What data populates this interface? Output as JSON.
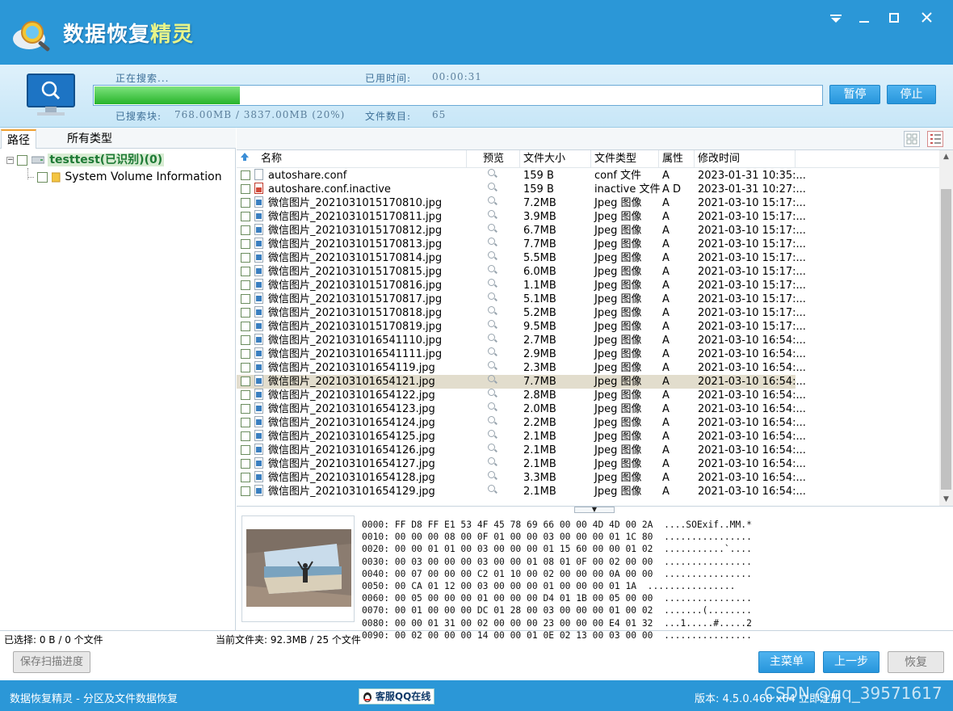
{
  "app": {
    "title_main": "数据恢复",
    "title_highlight": "精灵"
  },
  "window": {
    "min_icon": "minimize-icon",
    "max_icon": "maximize-icon",
    "close_icon": "close-icon"
  },
  "scan": {
    "status_label": "正在搜索...",
    "elapsed_label": "已用时间:",
    "elapsed_value": "00:00:31",
    "blocks_label": "已搜索块:",
    "blocks_value": "768.00MB / 3837.00MB (20%)",
    "files_label": "文件数目:",
    "files_value": "65",
    "progress": 0.2,
    "pause_label": "暂停",
    "stop_label": "停止"
  },
  "tabs": {
    "path": "路径",
    "types": "所有类型"
  },
  "tree": {
    "root": "testtest(已识别)(0)",
    "child": "System Volume Information"
  },
  "columns": {
    "name": "名称",
    "preview": "预览",
    "size": "文件大小",
    "type": "文件类型",
    "attr": "属性",
    "mtime": "修改时间"
  },
  "files": [
    {
      "name": "autoshare.conf",
      "size": "159 B",
      "type": "conf 文件",
      "attr": "A",
      "mtime": "2023-01-31 10:35:...",
      "icon": "doc"
    },
    {
      "name": "autoshare.conf.inactive",
      "size": "159 B",
      "type": "inactive 文件",
      "attr": "A D",
      "mtime": "2023-01-31 10:27:...",
      "icon": "del"
    },
    {
      "name": "微信图片_2021031015170810.jpg",
      "size": "7.2MB",
      "type": "Jpeg 图像",
      "attr": "A",
      "mtime": "2021-03-10 15:17:...",
      "icon": "img"
    },
    {
      "name": "微信图片_2021031015170811.jpg",
      "size": "3.9MB",
      "type": "Jpeg 图像",
      "attr": "A",
      "mtime": "2021-03-10 15:17:...",
      "icon": "img"
    },
    {
      "name": "微信图片_2021031015170812.jpg",
      "size": "6.7MB",
      "type": "Jpeg 图像",
      "attr": "A",
      "mtime": "2021-03-10 15:17:...",
      "icon": "img"
    },
    {
      "name": "微信图片_2021031015170813.jpg",
      "size": "7.7MB",
      "type": "Jpeg 图像",
      "attr": "A",
      "mtime": "2021-03-10 15:17:...",
      "icon": "img"
    },
    {
      "name": "微信图片_2021031015170814.jpg",
      "size": "5.5MB",
      "type": "Jpeg 图像",
      "attr": "A",
      "mtime": "2021-03-10 15:17:...",
      "icon": "img"
    },
    {
      "name": "微信图片_2021031015170815.jpg",
      "size": "6.0MB",
      "type": "Jpeg 图像",
      "attr": "A",
      "mtime": "2021-03-10 15:17:...",
      "icon": "img"
    },
    {
      "name": "微信图片_2021031015170816.jpg",
      "size": "1.1MB",
      "type": "Jpeg 图像",
      "attr": "A",
      "mtime": "2021-03-10 15:17:...",
      "icon": "img"
    },
    {
      "name": "微信图片_2021031015170817.jpg",
      "size": "5.1MB",
      "type": "Jpeg 图像",
      "attr": "A",
      "mtime": "2021-03-10 15:17:...",
      "icon": "img"
    },
    {
      "name": "微信图片_2021031015170818.jpg",
      "size": "5.2MB",
      "type": "Jpeg 图像",
      "attr": "A",
      "mtime": "2021-03-10 15:17:...",
      "icon": "img"
    },
    {
      "name": "微信图片_2021031015170819.jpg",
      "size": "9.5MB",
      "type": "Jpeg 图像",
      "attr": "A",
      "mtime": "2021-03-10 15:17:...",
      "icon": "img"
    },
    {
      "name": "微信图片_2021031016541110.jpg",
      "size": "2.7MB",
      "type": "Jpeg 图像",
      "attr": "A",
      "mtime": "2021-03-10 16:54:...",
      "icon": "img"
    },
    {
      "name": "微信图片_2021031016541111.jpg",
      "size": "2.9MB",
      "type": "Jpeg 图像",
      "attr": "A",
      "mtime": "2021-03-10 16:54:...",
      "icon": "img"
    },
    {
      "name": "微信图片_202103101654119.jpg",
      "size": "2.3MB",
      "type": "Jpeg 图像",
      "attr": "A",
      "mtime": "2021-03-10 16:54:...",
      "icon": "img"
    },
    {
      "name": "微信图片_202103101654121.jpg",
      "size": "7.7MB",
      "type": "Jpeg 图像",
      "attr": "A",
      "mtime": "2021-03-10 16:54:...",
      "icon": "img",
      "selected": true
    },
    {
      "name": "微信图片_202103101654122.jpg",
      "size": "2.8MB",
      "type": "Jpeg 图像",
      "attr": "A",
      "mtime": "2021-03-10 16:54:...",
      "icon": "img"
    },
    {
      "name": "微信图片_202103101654123.jpg",
      "size": "2.0MB",
      "type": "Jpeg 图像",
      "attr": "A",
      "mtime": "2021-03-10 16:54:...",
      "icon": "img"
    },
    {
      "name": "微信图片_202103101654124.jpg",
      "size": "2.2MB",
      "type": "Jpeg 图像",
      "attr": "A",
      "mtime": "2021-03-10 16:54:...",
      "icon": "img"
    },
    {
      "name": "微信图片_202103101654125.jpg",
      "size": "2.1MB",
      "type": "Jpeg 图像",
      "attr": "A",
      "mtime": "2021-03-10 16:54:...",
      "icon": "img"
    },
    {
      "name": "微信图片_202103101654126.jpg",
      "size": "2.1MB",
      "type": "Jpeg 图像",
      "attr": "A",
      "mtime": "2021-03-10 16:54:...",
      "icon": "img"
    },
    {
      "name": "微信图片_202103101654127.jpg",
      "size": "2.1MB",
      "type": "Jpeg 图像",
      "attr": "A",
      "mtime": "2021-03-10 16:54:...",
      "icon": "img"
    },
    {
      "name": "微信图片_202103101654128.jpg",
      "size": "3.3MB",
      "type": "Jpeg 图像",
      "attr": "A",
      "mtime": "2021-03-10 16:54:...",
      "icon": "img"
    },
    {
      "name": "微信图片_202103101654129.jpg",
      "size": "2.1MB",
      "type": "Jpeg 图像",
      "attr": "A",
      "mtime": "2021-03-10 16:54:...",
      "icon": "img"
    }
  ],
  "hex": [
    "0000: FF D8 FF E1 53 4F 45 78 69 66 00 00 4D 4D 00 2A  ....SOExif..MM.*",
    "0010: 00 00 00 08 00 0F 01 00 00 03 00 00 00 01 1C 80  ................",
    "0020: 00 00 01 01 00 03 00 00 00 01 15 60 00 00 01 02  ...........`....",
    "0030: 00 03 00 00 00 03 00 00 01 08 01 0F 00 02 00 00  ................",
    "0040: 00 07 00 00 00 C2 01 10 00 02 00 00 00 0A 00 00  ................",
    "0050: 00 CA 01 12 00 03 00 00 00 01 00 00 00 01 1A  ................",
    "0060: 00 05 00 00 00 01 00 00 00 D4 01 1B 00 05 00 00  ................",
    "0070: 00 01 00 00 00 DC 01 28 00 03 00 00 00 01 00 02  .......(........",
    "0080: 00 00 01 31 00 02 00 00 00 23 00 00 00 E4 01 32  ...1.....#.....2",
    "0090: 00 02 00 00 00 14 00 00 01 0E 02 13 00 03 00 00  ................"
  ],
  "status": {
    "selected": "已选择: 0 B / 0 个文件",
    "current_folder": "当前文件夹: 92.3MB / 25 个文件"
  },
  "buttons": {
    "save_progress": "保存扫描进度",
    "main_menu": "主菜单",
    "prev_step": "上一步",
    "recover": "恢复"
  },
  "footer": {
    "left_text": "数据恢复精灵 - 分区及文件数据恢复",
    "qq": "客服QQ在线",
    "version_label": "版本: 4.5.0.460 x64  立即注册",
    "watermark": "CSDN @qq_39571617"
  },
  "colors": {
    "accent": "#2b97d7",
    "progress": "#27b32a",
    "selected_row": "#e2ddcd"
  }
}
